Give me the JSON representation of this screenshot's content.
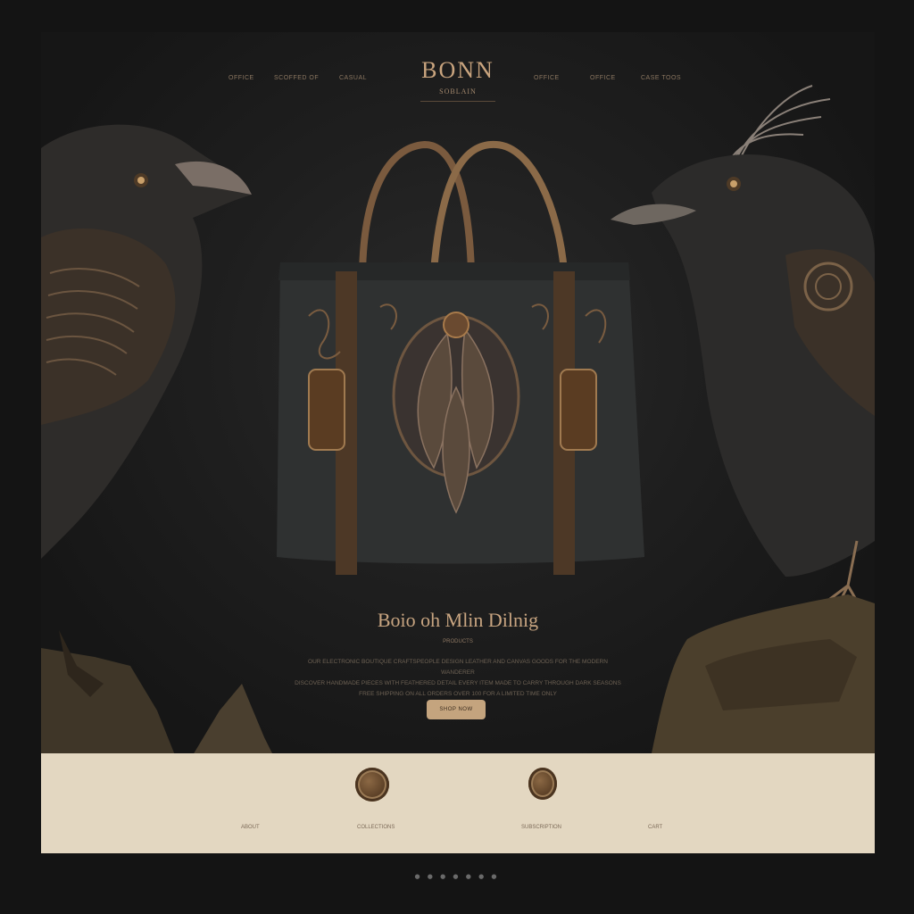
{
  "brand": {
    "title": "BONN",
    "subtitle": "SOBLAIN"
  },
  "nav": {
    "left": [
      "OFFICE",
      "SCOFFED OF",
      "CASUAL"
    ],
    "right": [
      "OFFICE",
      "OFFICE",
      "CASE TOOS"
    ]
  },
  "hero": {
    "headline": "Boio oh Mlin Dilnig",
    "kicker": "PRODUCTS",
    "body_lines": [
      "OUR ELECTRONIC BOUTIQUE CRAFTSPEOPLE DESIGN LEATHER AND CANVAS GOODS FOR THE MODERN WANDERER",
      "DISCOVER HANDMADE PIECES WITH FEATHERED DETAIL EVERY ITEM MADE TO CARRY THROUGH DARK SEASONS",
      "FREE SHIPPING ON ALL ORDERS OVER 100 FOR A LIMITED TIME ONLY"
    ],
    "cta_label": "SHOP NOW"
  },
  "footer": {
    "labels": [
      "ABOUT",
      "COLLECTIONS",
      "SUBSCRIPTION",
      "CART"
    ]
  },
  "pagination": "● ● ● ● ● ● ●",
  "colors": {
    "accent": "#c4a47e",
    "background": "#141414",
    "band": "#e3d7c1"
  }
}
